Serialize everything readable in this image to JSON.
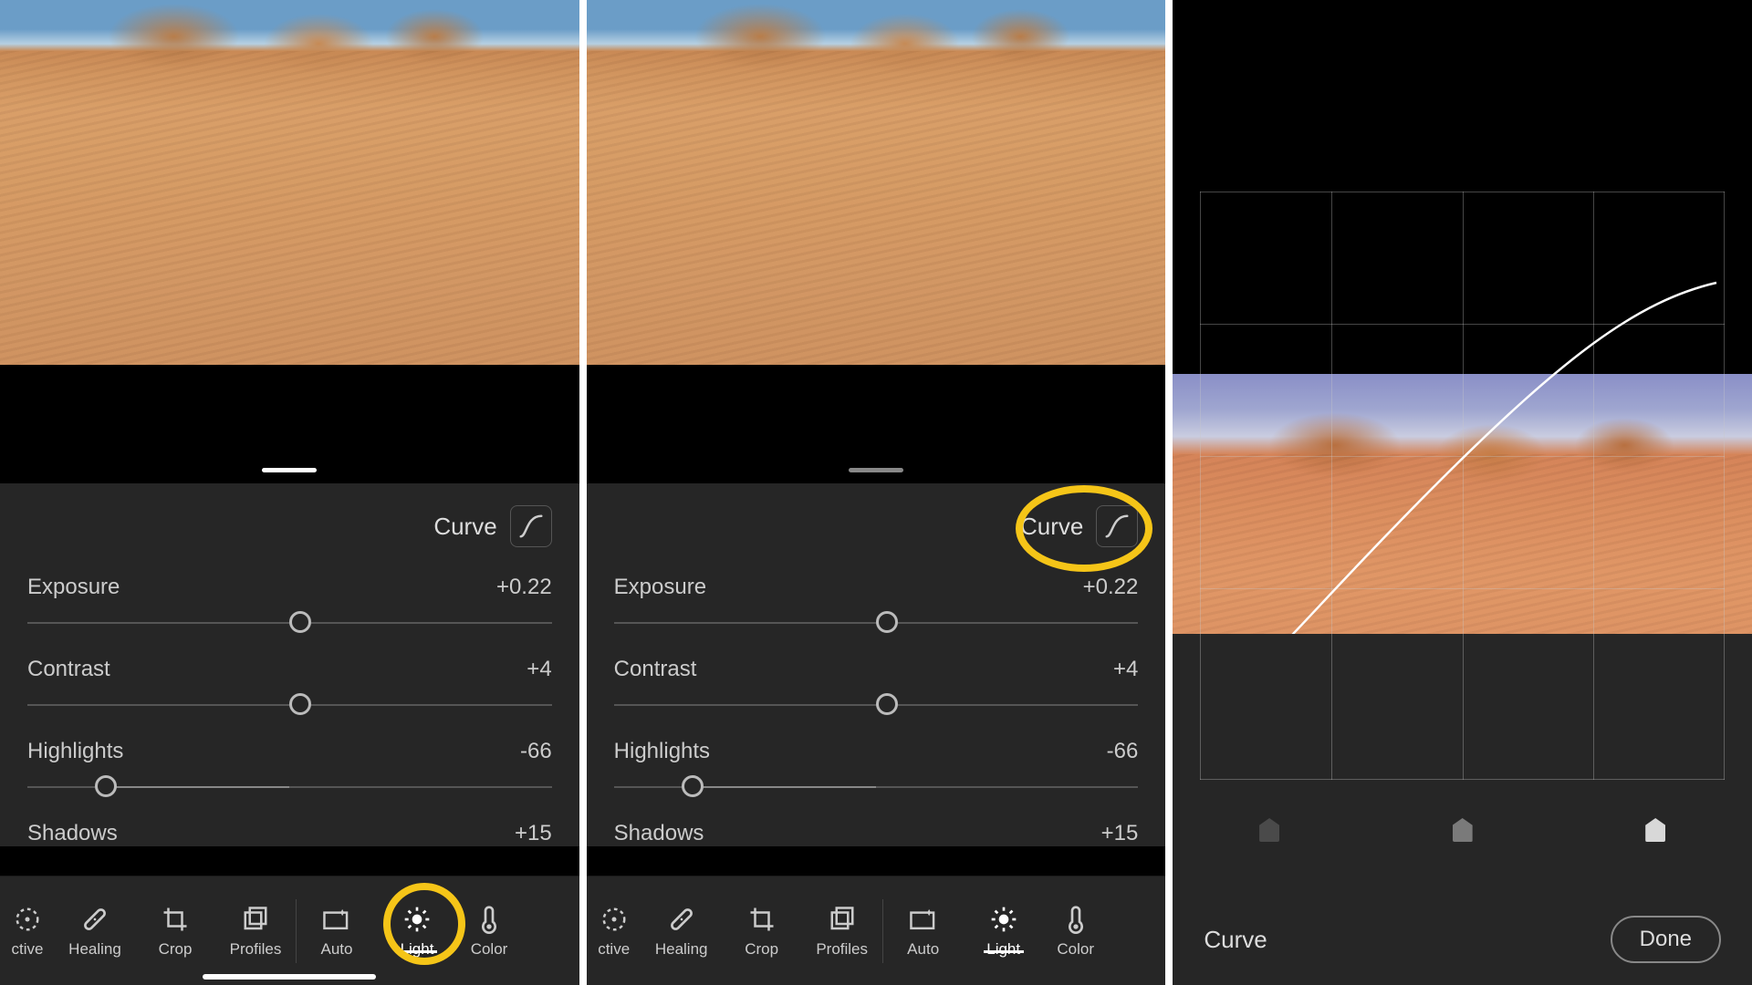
{
  "curve_button_label": "Curve",
  "sliders": {
    "exposure": {
      "label": "Exposure",
      "value": "+0.22",
      "pos": 52
    },
    "contrast": {
      "label": "Contrast",
      "value": "+4",
      "pos": 52
    },
    "highlights": {
      "label": "Highlights",
      "value": "-66",
      "pos": 15
    },
    "shadows": {
      "label": "Shadows",
      "value": "+15"
    }
  },
  "toolbar": {
    "selective": "ctive",
    "healing": "Healing",
    "crop": "Crop",
    "profiles": "Profiles",
    "auto": "Auto",
    "light": "Light",
    "color": "Color"
  },
  "panel3": {
    "curve_label": "Curve",
    "done_label": "Done"
  }
}
